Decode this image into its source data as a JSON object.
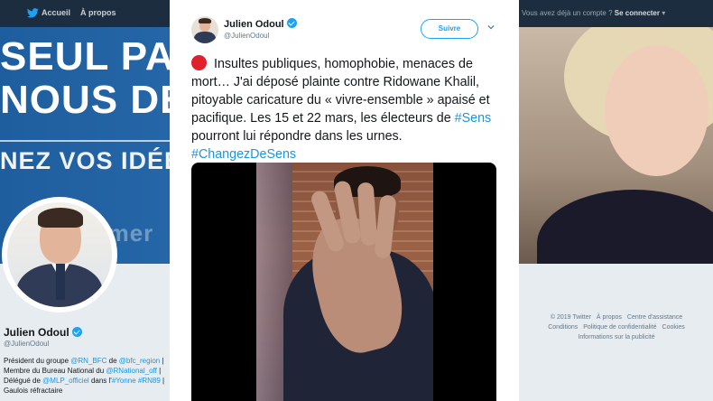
{
  "topbar": {
    "nav": [
      {
        "label": "Accueil",
        "icon": "home-icon"
      },
      {
        "label": "À propos"
      }
    ],
    "account_prompt": "Vous avez déjà un compte ?",
    "login_label": "Se connecter",
    "login_icon": "chevron-down-icon"
  },
  "banner": {
    "line1": "SEUL PA",
    "line2": "NOUS DE",
    "line3": "NEZ VOS IDÉES",
    "line4": "ammer"
  },
  "profile": {
    "name": "Julien Odoul",
    "handle": "@JulienOdoul",
    "bio": [
      {
        "text": "Président du groupe ",
        "link": false
      },
      {
        "text": "@RN_BFC",
        "link": true
      },
      {
        "text": " de ",
        "link": false
      },
      {
        "text": "@bfc_region",
        "link": true
      },
      {
        "text": " | Membre du Bureau National du ",
        "link": false
      },
      {
        "text": "@RNational_off",
        "link": true
      },
      {
        "text": " | Délégué de ",
        "link": false
      },
      {
        "text": "@MLP_officiel",
        "link": true
      },
      {
        "text": " dans l'",
        "link": false
      },
      {
        "text": "#Yonne",
        "link": true
      },
      {
        "text": " ",
        "link": false
      },
      {
        "text": "#RN89",
        "link": true
      },
      {
        "text": " | Gaulois réfractaire",
        "link": false
      }
    ]
  },
  "footer": {
    "links": [
      "© 2019 Twitter",
      "À propos",
      "Centre d'assistance",
      "Conditions",
      "Politique de confidentialité",
      "Cookies",
      "Informations sur la publicité"
    ]
  },
  "tweet": {
    "author_name": "Julien Odoul",
    "author_handle": "@JulienOdoul",
    "follow_label": "Suivre",
    "text_parts": [
      {
        "text": " Insultes publiques, homophobie, menaces de mort… J'ai déposé plainte contre Ridowane Khalil, pitoyable caricature du « vivre-ensemble » apaisé et pacifique. Les 15 et 22 mars, les électeurs de ",
        "link": false
      },
      {
        "text": "#Sens",
        "link": true
      },
      {
        "text": " pourront lui répondre dans les urnes. ",
        "link": false
      },
      {
        "text": "#ChangezDeSens",
        "link": true
      }
    ]
  },
  "colors": {
    "accent": "#1da1f2",
    "link": "#1b95e0",
    "topbar": "#1c2d3f",
    "red_circle": "#e0202a"
  }
}
